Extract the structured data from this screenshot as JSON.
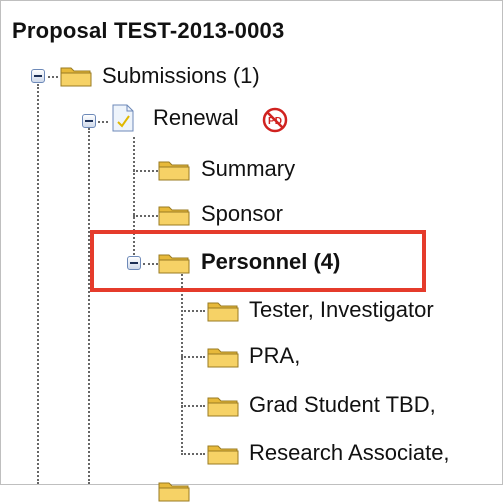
{
  "tree": {
    "title": "Proposal TEST-2013-0003",
    "submissions": {
      "label": "Submissions (1)"
    },
    "renewal": {
      "label": "Renewal",
      "badge_icon": "no-pd-icon",
      "badge_text": "PD"
    },
    "summary": {
      "label": "Summary"
    },
    "sponsor": {
      "label": "Sponsor"
    },
    "personnel": {
      "label": "Personnel (4)",
      "highlighted": true
    },
    "people": [
      {
        "label": "Tester, Investigator"
      },
      {
        "label": "PRA,"
      },
      {
        "label": "Grad Student TBD,"
      },
      {
        "label": "Research Associate,"
      }
    ]
  },
  "colors": {
    "highlight": "#e53b2b",
    "folder": "#f3c94f",
    "connector": "#666666"
  }
}
